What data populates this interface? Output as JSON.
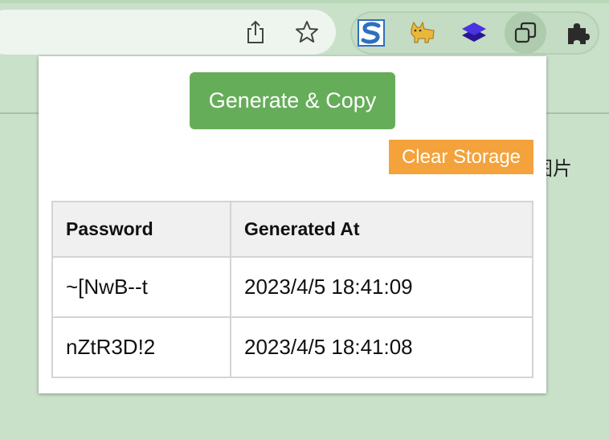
{
  "browser": {
    "toolbar_icons": [
      "share-icon",
      "bookmark-star-icon"
    ],
    "extensions": [
      {
        "name": "s-extension-icon",
        "color": "#2f6fbf"
      },
      {
        "name": "cat-extension-icon",
        "color": "#e8b83a"
      },
      {
        "name": "layers-extension-icon",
        "color": "#3a1fc1"
      },
      {
        "name": "copy-extension-icon",
        "color": "#2b2b2b"
      },
      {
        "name": "puzzle-extensions-icon",
        "color": "#2b2b2b"
      }
    ],
    "background_text": "图片"
  },
  "popup": {
    "generate_button_label": "Generate & Copy",
    "generate_button_color": "#66ad5a",
    "clear_button_label": "Clear Storage",
    "clear_button_color": "#f4a23b",
    "table": {
      "headers": [
        "Password",
        "Generated At"
      ],
      "rows": [
        [
          "~[NwB--t",
          "2023/4/5 18:41:09"
        ],
        [
          "nZtR3D!2",
          "2023/4/5 18:41:08"
        ]
      ]
    }
  }
}
